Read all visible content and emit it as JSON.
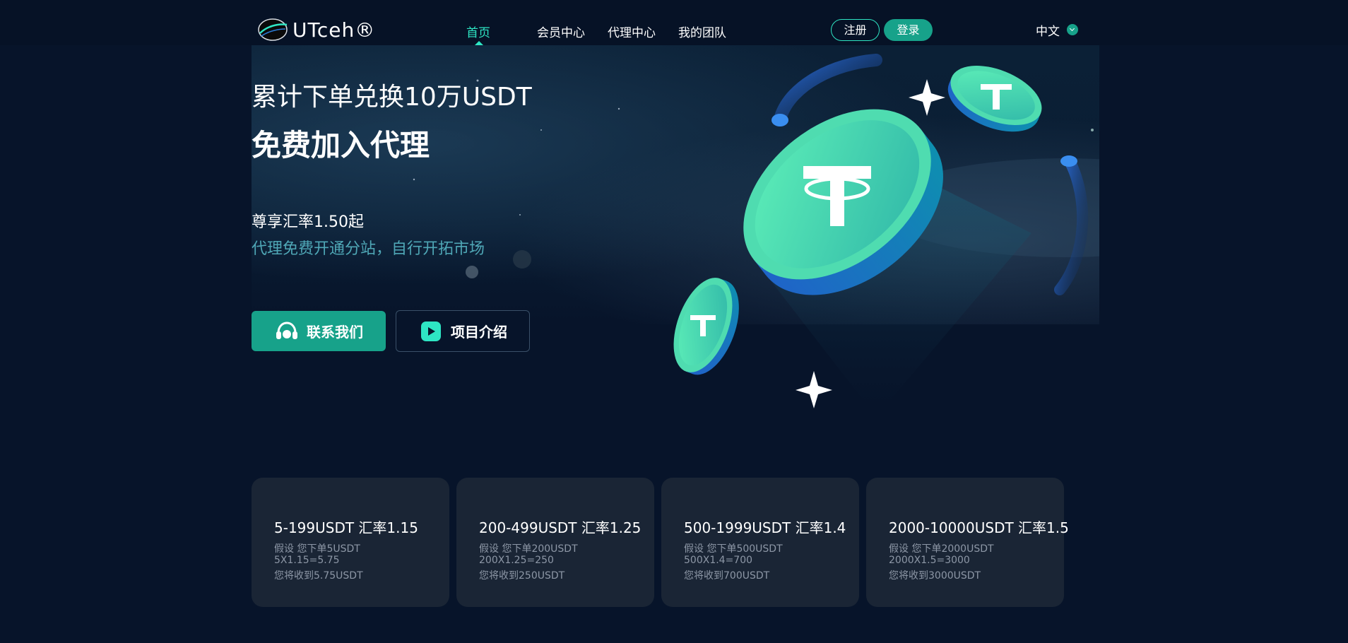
{
  "header": {
    "logo_text": "UTceh®",
    "nav": [
      {
        "label": "首页",
        "active": true
      },
      {
        "label": "会员中心",
        "active": false
      },
      {
        "label": "代理中心",
        "active": false
      },
      {
        "label": "我的团队",
        "active": false
      }
    ],
    "register_label": "注册",
    "login_label": "登录",
    "language": "中文"
  },
  "hero": {
    "line1": "累计下单兑换10万USDT",
    "line2": "免费加入代理",
    "rate": "尊享汇率1.50起",
    "subtitle": "代理免费开通分站，自行开拓市场",
    "contact_label": "联系我们",
    "intro_label": "项目介绍"
  },
  "colors": {
    "background": "#07142a",
    "accent": "#17a28a",
    "nav_active": "#2ee6c4",
    "subtitle": "#4fa7b6",
    "card_bg": "#1a2535"
  },
  "cards": [
    {
      "title": "5-199USDT 汇率1.15",
      "line1": "假设 您下单5USDT",
      "line2": "5X1.15=5.75",
      "line3": "您将收到5.75USDT"
    },
    {
      "title": "200-499USDT 汇率1.25",
      "line1": "假设 您下单200USDT",
      "line2": "200X1.25=250",
      "line3": "您将收到250USDT"
    },
    {
      "title": "500-1999USDT 汇率1.4",
      "line1": "假设 您下单500USDT",
      "line2": "500X1.4=700",
      "line3": "您将收到700USDT"
    },
    {
      "title": "2000-10000USDT 汇率1.5",
      "line1": "假设 您下单2000USDT",
      "line2": "2000X1.5=3000",
      "line3": "您将收到3000USDT"
    }
  ]
}
